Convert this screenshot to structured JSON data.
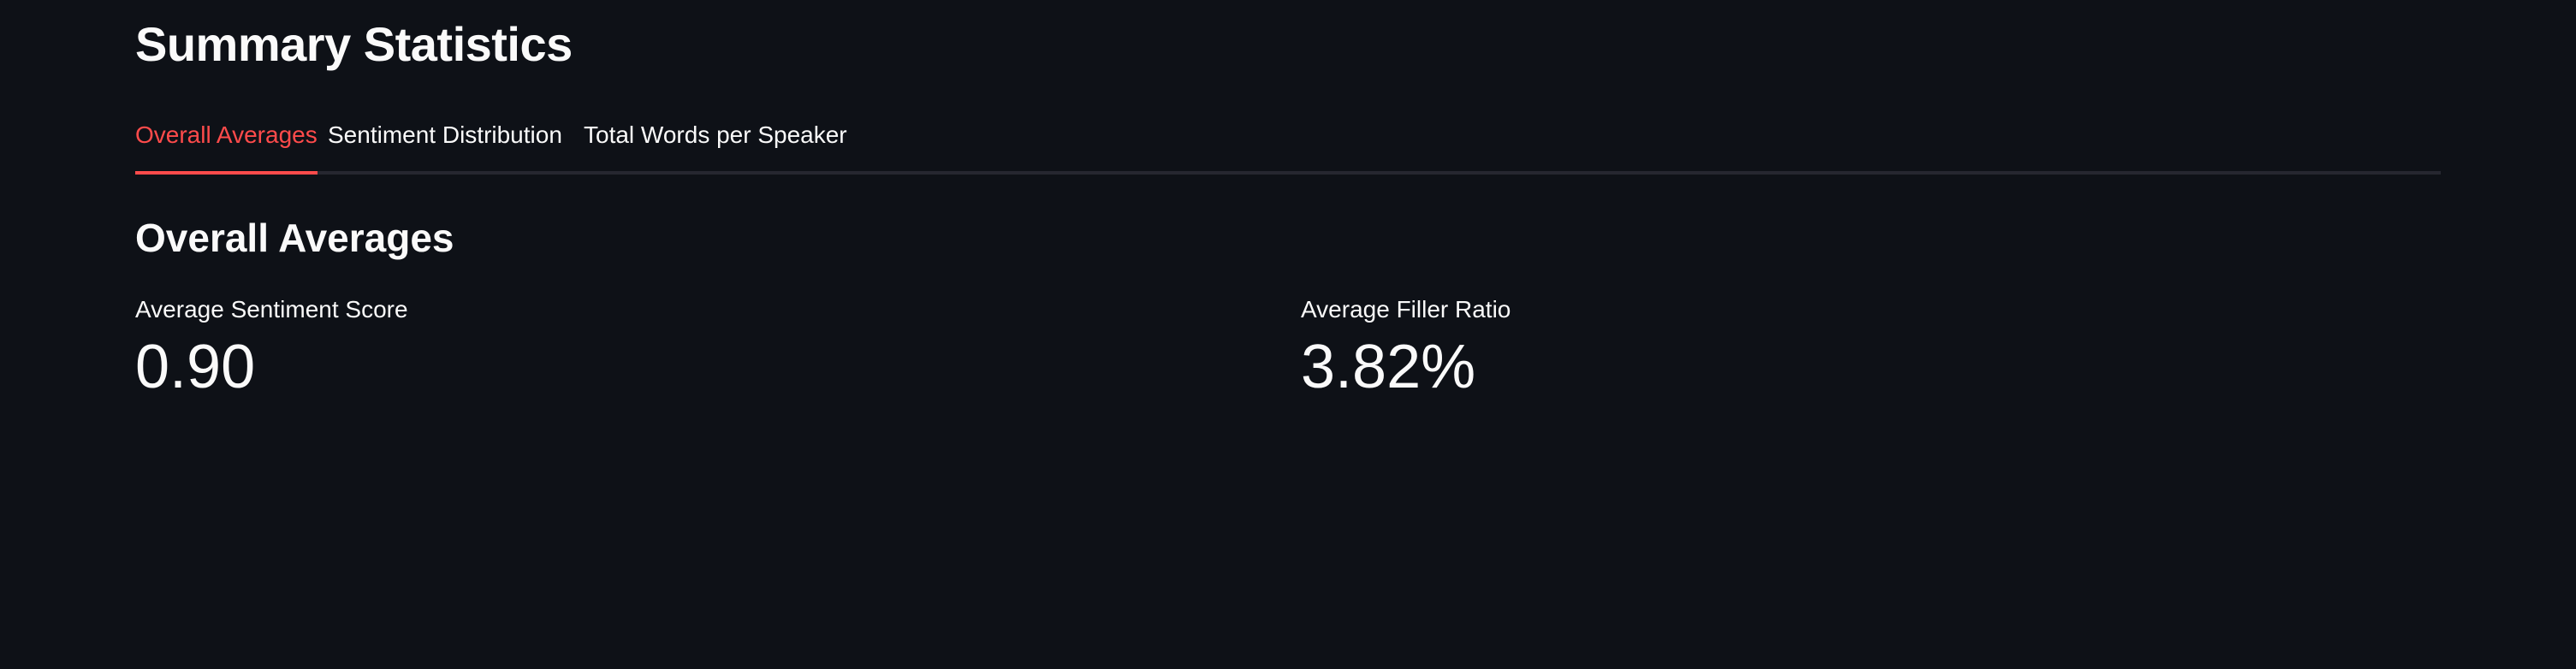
{
  "page": {
    "title": "Summary Statistics",
    "background_color": "#0e1117",
    "accent_color": "#ff4b4b"
  },
  "tabs": [
    {
      "label": "Overall Averages",
      "active": true
    },
    {
      "label": "Sentiment Distribution",
      "active": false
    },
    {
      "label": "Total Words per Speaker",
      "active": false
    }
  ],
  "section": {
    "title": "Overall Averages"
  },
  "metrics": [
    {
      "label": "Average Sentiment Score",
      "value": "0.90"
    },
    {
      "label": "Average Filler Ratio",
      "value": "3.82%"
    }
  ]
}
